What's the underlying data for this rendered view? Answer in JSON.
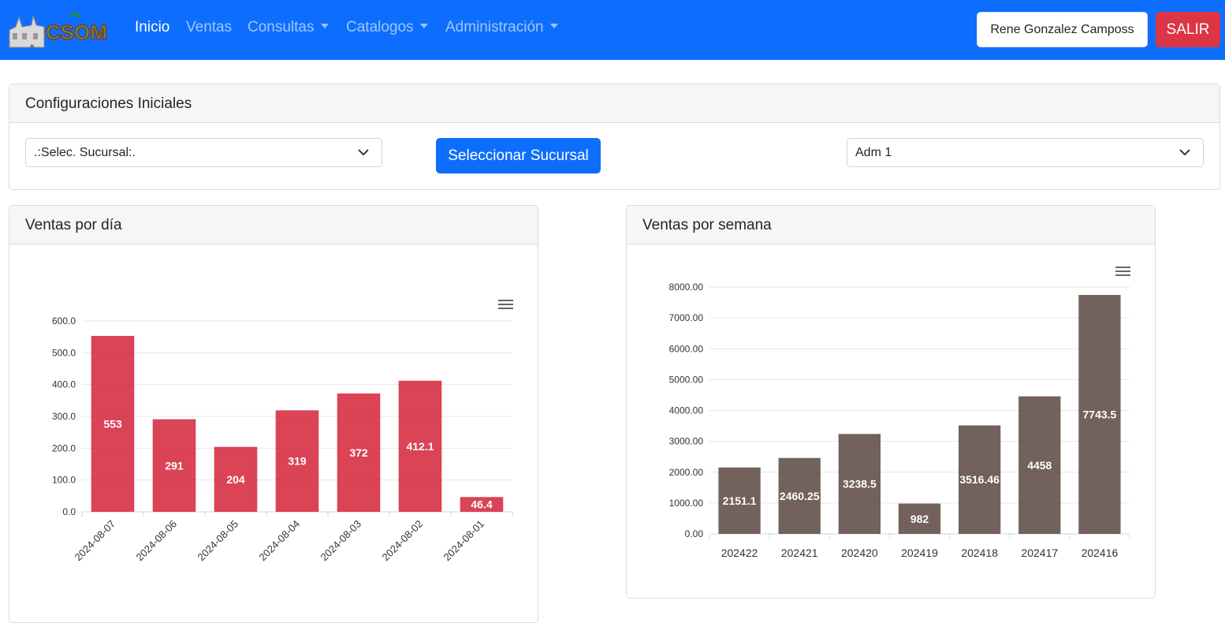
{
  "colors": {
    "navbar": "#0d6efd",
    "daily_bar": "#d6293f",
    "weekly_bar": "#5f4b45",
    "danger": "#dc3545"
  },
  "navbar": {
    "brand_text": "CSOM",
    "items": [
      {
        "label": "Inicio",
        "active": true,
        "dropdown": false
      },
      {
        "label": "Ventas",
        "active": false,
        "dropdown": false
      },
      {
        "label": "Consultas",
        "active": false,
        "dropdown": true
      },
      {
        "label": "Catalogos",
        "active": false,
        "dropdown": true
      },
      {
        "label": "Administración",
        "active": false,
        "dropdown": true
      }
    ],
    "user_name": "Rene Gonzalez Camposs",
    "logout_label": "SALIR"
  },
  "config": {
    "title": "Configuraciones Iniciales",
    "branch_select_value": ".:Selec. Sucursal:.",
    "select_button_label": "Seleccionar Sucursal",
    "admin_select_value": "Adm 1"
  },
  "daily_card": {
    "title": "Ventas por día",
    "menu_icon": "hamburger-icon"
  },
  "weekly_card": {
    "title": "Ventas por semana",
    "menu_icon": "hamburger-icon"
  },
  "chart_data": [
    {
      "type": "bar",
      "title": "Ventas por día",
      "categories": [
        "2024-08-07",
        "2024-08-06",
        "2024-08-05",
        "2024-08-04",
        "2024-08-03",
        "2024-08-02",
        "2024-08-01"
      ],
      "values": [
        553,
        291,
        204,
        319,
        372,
        412.1,
        46.4
      ],
      "data_labels": [
        "553",
        "291",
        "204",
        "319",
        "372",
        "412.1",
        "46.4"
      ],
      "yticks": [
        "0.0",
        "100.0",
        "200.0",
        "300.0",
        "400.0",
        "500.0",
        "600.0"
      ],
      "ylim": [
        0,
        600
      ],
      "color": "#d6293f",
      "grid": true,
      "legend": false
    },
    {
      "type": "bar",
      "title": "Ventas por semana",
      "categories": [
        "202422",
        "202421",
        "202420",
        "202419",
        "202418",
        "202417",
        "202416"
      ],
      "values": [
        2151.1,
        2460.25,
        3238.5,
        982,
        3516.46,
        4458,
        7743.5
      ],
      "data_labels": [
        "2151.1",
        "2460.25",
        "3238.5",
        "982",
        "3516.46",
        "4458",
        "7743.5"
      ],
      "yticks": [
        "0.00",
        "1000.00",
        "2000.00",
        "3000.00",
        "4000.00",
        "5000.00",
        "6000.00",
        "7000.00",
        "8000.00"
      ],
      "ylim": [
        0,
        8000
      ],
      "color": "#5f4b45",
      "grid": true,
      "legend": false
    }
  ]
}
